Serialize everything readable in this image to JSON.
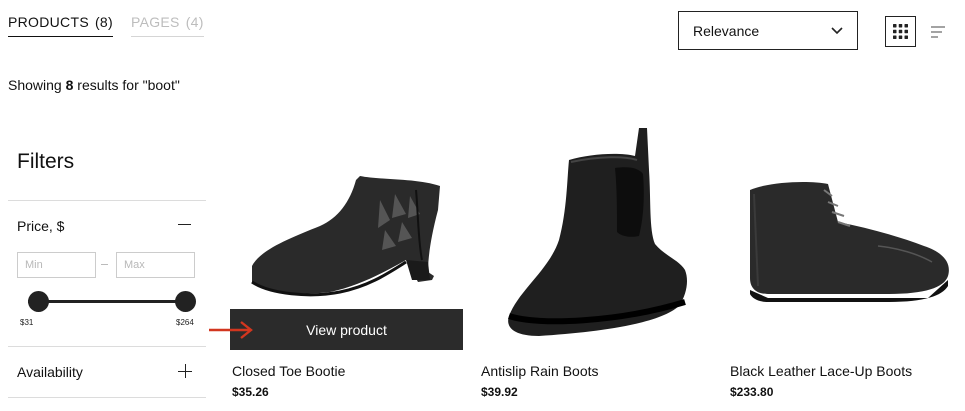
{
  "tabs": [
    {
      "label": "PRODUCTS",
      "count": "(8)"
    },
    {
      "label": "PAGES",
      "count": "(4)"
    }
  ],
  "sort": {
    "selected": "Relevance"
  },
  "view_toggle": {
    "grid_icon": "grid-icon",
    "list_icon": "sort-lines-icon"
  },
  "results": {
    "prefix": "Showing ",
    "count": "8",
    "suffix": " results for \"boot\""
  },
  "filters": {
    "title": "Filters",
    "price": {
      "label": "Price, $",
      "min_placeholder": "Min",
      "max_placeholder": "Max",
      "slider_min_label": "$31",
      "slider_max_label": "$264"
    },
    "availability": {
      "label": "Availability"
    }
  },
  "products": [
    {
      "name": "Closed Toe Bootie",
      "price": "$35.26",
      "image_icon": "ankle-bootie-image"
    },
    {
      "name": "Antislip Rain Boots",
      "price": "$39.92",
      "image_icon": "chelsea-rain-boot-image"
    },
    {
      "name": "Black Leather Lace-Up Boots",
      "price": "$233.80",
      "image_icon": "lace-up-boot-image"
    }
  ],
  "hover": {
    "view_product_label": "View product"
  },
  "colors": {
    "accent_arrow": "#d2361f",
    "button_dark": "#2b2b2b"
  }
}
